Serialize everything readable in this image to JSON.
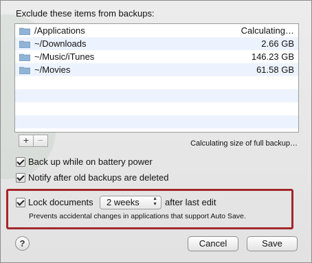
{
  "heading": "Exclude these items from backups:",
  "items": [
    {
      "name": "/Applications",
      "size": "Calculating…"
    },
    {
      "name": "~/Downloads",
      "size": "2.66 GB"
    },
    {
      "name": "~/Music/iTunes",
      "size": "146.23 GB"
    },
    {
      "name": "~/Movies",
      "size": "61.58 GB"
    }
  ],
  "add_label": "+",
  "remove_label": "−",
  "calc_status": "Calculating size of full backup…",
  "options": {
    "battery_label": "Back up while on battery power",
    "notify_label": "Notify after old backups are deleted",
    "lock_label": "Lock documents",
    "lock_period": "2 weeks",
    "lock_after": "after last edit",
    "lock_note": "Prevents accidental changes in applications that support Auto Save."
  },
  "help_label": "?",
  "cancel_label": "Cancel",
  "save_label": "Save",
  "colors": {
    "highlight_border": "#a2262b",
    "list_alt_row": "#edf3fe"
  }
}
